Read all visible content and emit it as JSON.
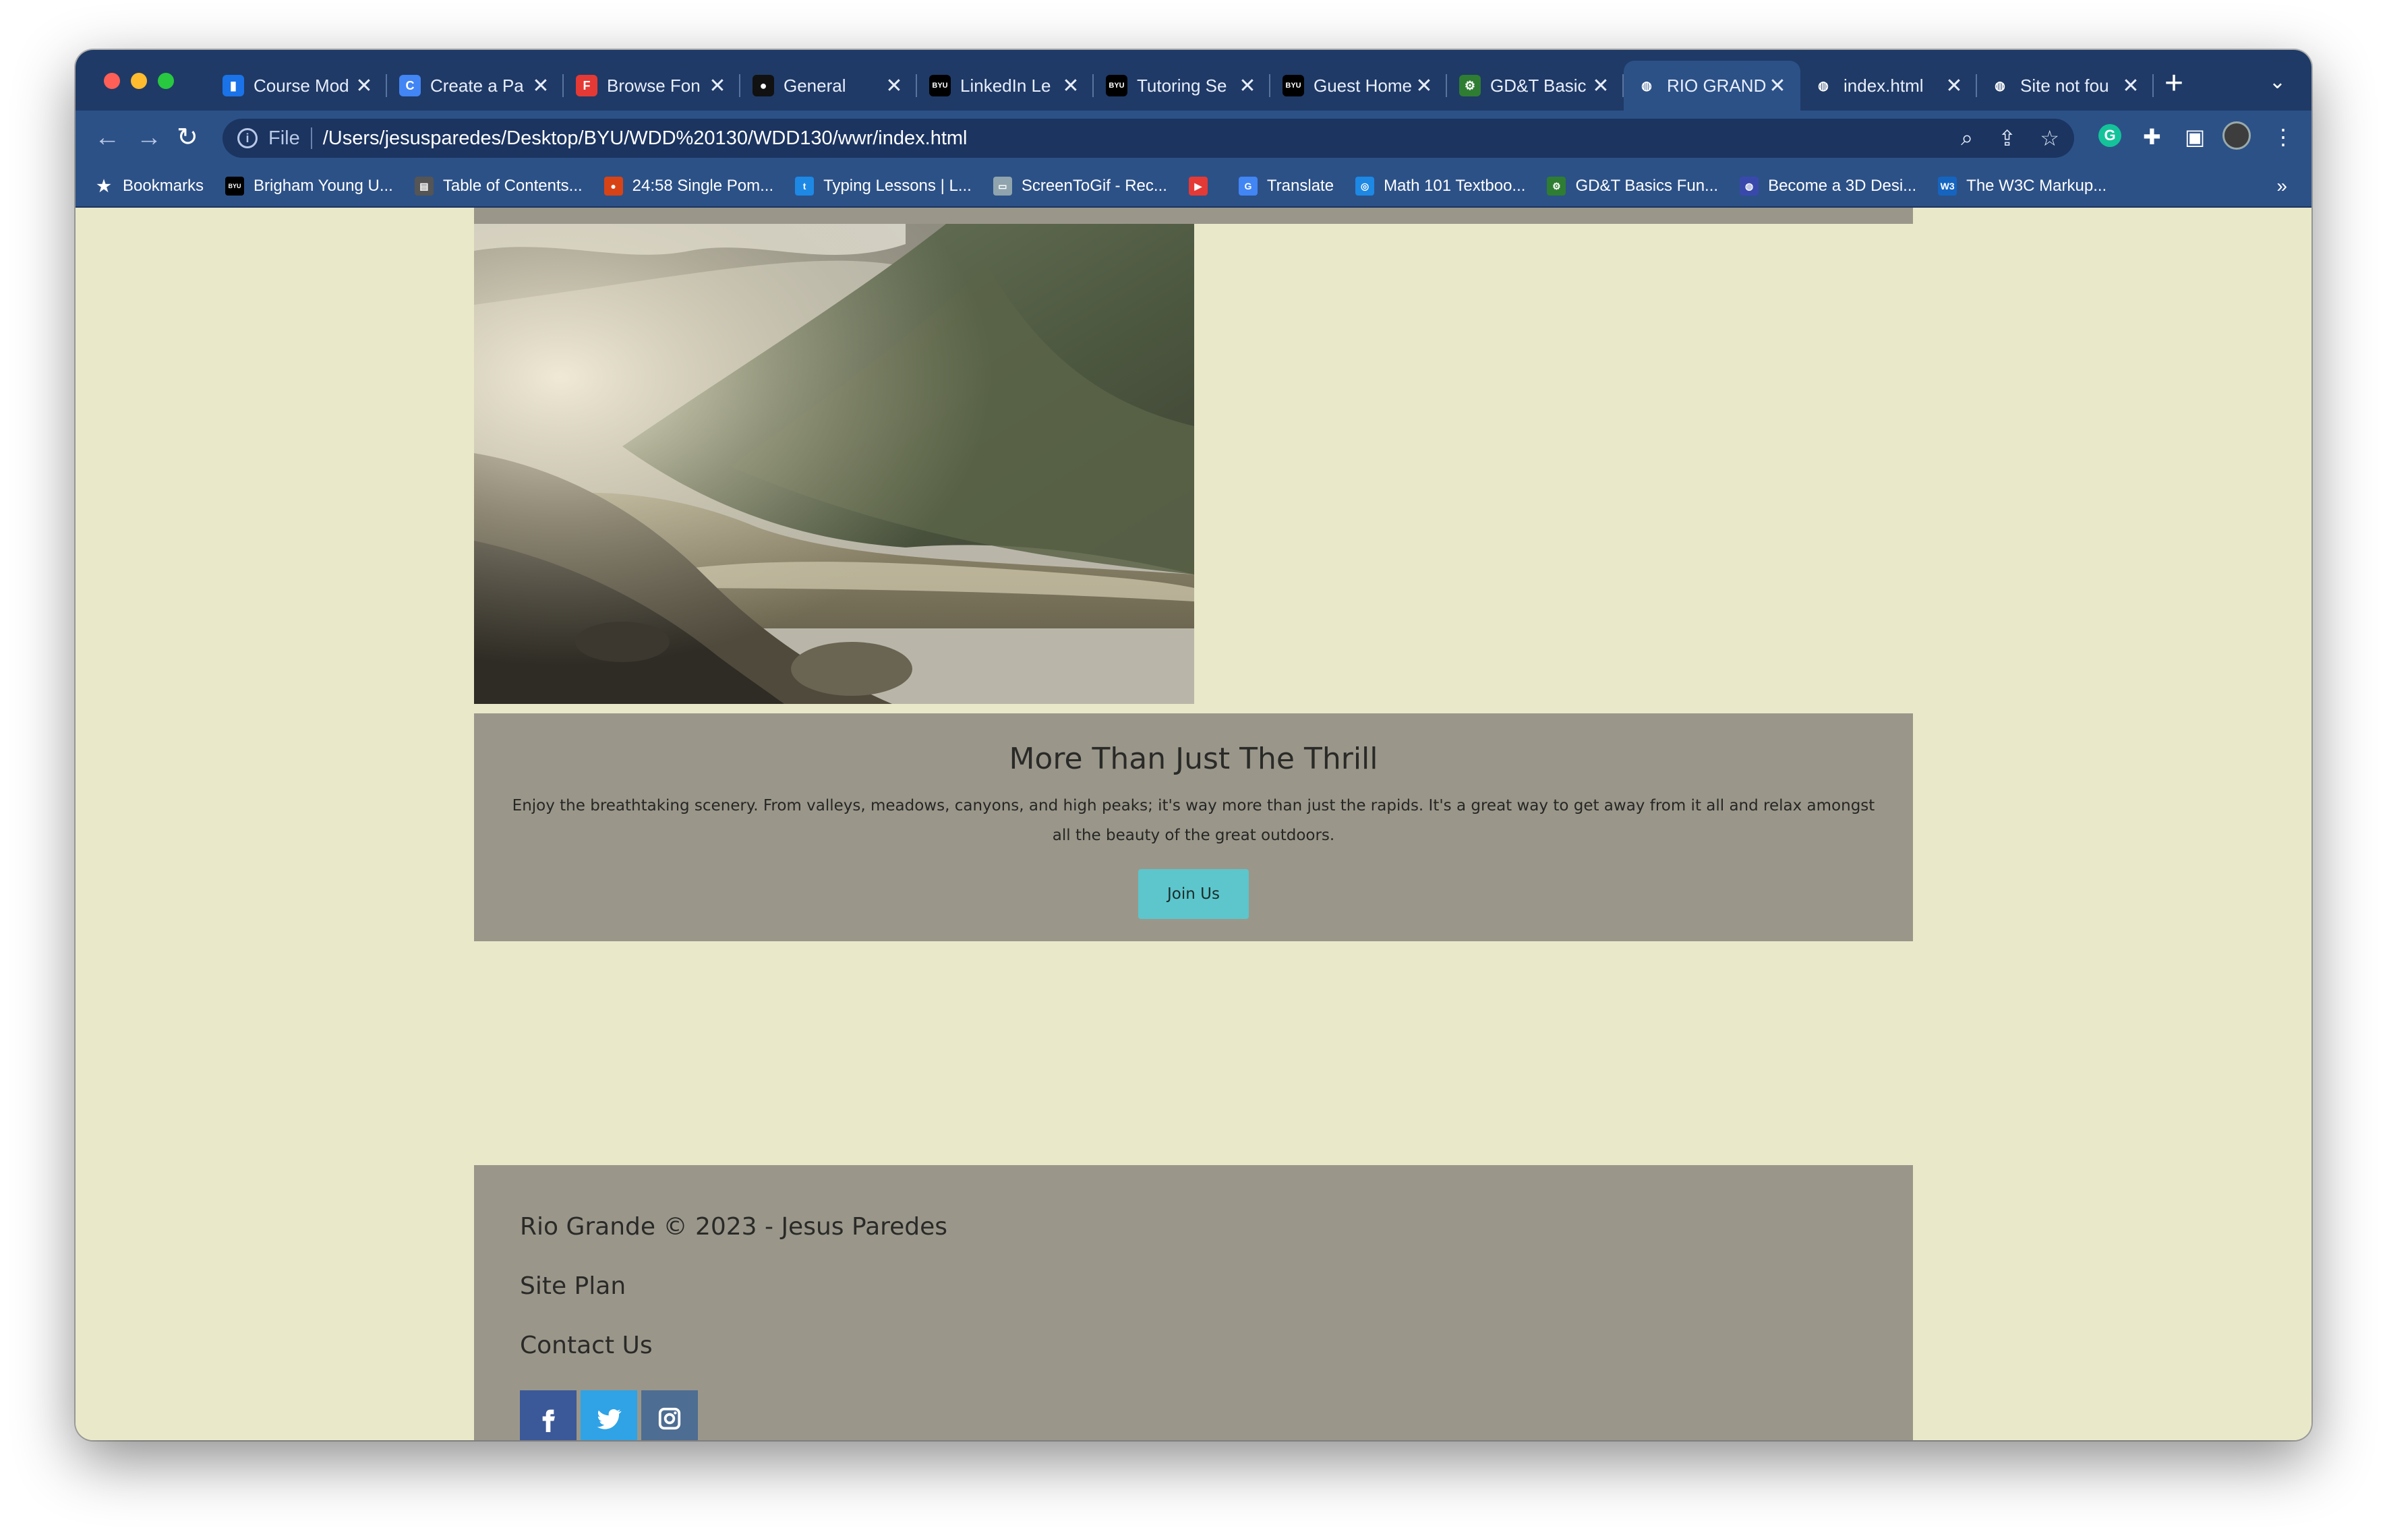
{
  "browser": {
    "tabs": [
      {
        "title": "Course Mod",
        "icon": "chart-icon",
        "color": "#1a73e8",
        "glyph": "▮"
      },
      {
        "title": "Create a Pa",
        "icon": "circle-c-icon",
        "color": "#4285f4",
        "glyph": "C"
      },
      {
        "title": "Browse Fon",
        "icon": "fonts-icon",
        "color": "#e53935",
        "glyph": "F"
      },
      {
        "title": "General",
        "icon": "github-icon",
        "color": "#111111",
        "glyph": "●"
      },
      {
        "title": "LinkedIn Le",
        "icon": "byu-icon",
        "color": "#000000",
        "glyph": "BYU"
      },
      {
        "title": "Tutoring Se",
        "icon": "byu-icon",
        "color": "#000000",
        "glyph": "BYU"
      },
      {
        "title": "Guest Home",
        "icon": "byu-icon",
        "color": "#000000",
        "glyph": "BYU"
      },
      {
        "title": "GD&T Basic",
        "icon": "gear-icon",
        "color": "#2e7d32",
        "glyph": "⚙"
      },
      {
        "title": "RIO GRANDE",
        "icon": "globe-icon",
        "color": "#2c5187",
        "glyph": "◍"
      },
      {
        "title": "index.html",
        "icon": "globe-icon",
        "color": "#1f3a66",
        "glyph": "◍"
      },
      {
        "title": "Site not fou",
        "icon": "globe-icon",
        "color": "#1f3a66",
        "glyph": "◍"
      }
    ],
    "active_tab": 8,
    "close_glyph": "✕",
    "new_tab_glyph": "+",
    "address": {
      "scheme_label": "File",
      "url": "/Users/jesusparedes/Desktop/BYU/WDD%20130/WDD130/wwr/index.html"
    },
    "bookmarks": [
      {
        "label": "Bookmarks",
        "icon": "star-icon",
        "color": "#2c5187",
        "glyph": "★"
      },
      {
        "label": "Brigham Young U...",
        "icon": "byu-icon",
        "color": "#000000",
        "glyph": "BYU"
      },
      {
        "label": "Table of Contents...",
        "icon": "book-icon",
        "color": "#555555",
        "glyph": "▤"
      },
      {
        "label": "24:58 Single Pom...",
        "icon": "tomato-icon",
        "color": "#d84315",
        "glyph": "●"
      },
      {
        "label": "Typing Lessons | L...",
        "icon": "typing-icon",
        "color": "#1e88e5",
        "glyph": "t"
      },
      {
        "label": "ScreenToGif - Rec...",
        "icon": "screen-icon",
        "color": "#90a4ae",
        "glyph": "▭"
      },
      {
        "label": "",
        "icon": "youtube-icon",
        "color": "#e53935",
        "glyph": "▶"
      },
      {
        "label": "Translate",
        "icon": "translate-icon",
        "color": "#4285f4",
        "glyph": "G"
      },
      {
        "label": "Math 101 Textboo...",
        "icon": "math-icon",
        "color": "#1e88e5",
        "glyph": "◎"
      },
      {
        "label": "GD&T Basics Fun...",
        "icon": "gear-icon",
        "color": "#2e7d32",
        "glyph": "⚙"
      },
      {
        "label": "Become a 3D Desi...",
        "icon": "globe-icon",
        "color": "#3949ab",
        "glyph": "◍"
      },
      {
        "label": "The W3C Markup...",
        "icon": "w3c-icon",
        "color": "#1565c0",
        "glyph": "W3"
      }
    ],
    "more_glyph": "»"
  },
  "page": {
    "section": {
      "heading": "More Than Just The Thrill",
      "text": "Enjoy the breathtaking scenery. From valleys, meadows, canyons, and high peaks; it's way more than just the rapids. It's a great way to get away from it all and relax amongst all the beauty of the great outdoors.",
      "button": "Join Us",
      "button_color": "#5cc6cc"
    },
    "footer": {
      "copyright": "Rio Grande © 2023 - Jesus Paredes",
      "site_plan": "Site Plan",
      "contact": "Contact Us",
      "social": [
        {
          "name": "facebook-icon",
          "glyph": "f",
          "color": "#3b5998"
        },
        {
          "name": "twitter-icon",
          "glyph": "🐦",
          "color": "#2fa3e6"
        },
        {
          "name": "instagram-icon",
          "glyph": "◘",
          "color": "#4d6d92"
        }
      ]
    },
    "background_color": "#e9e8c9",
    "panel_color": "#9a978a"
  }
}
